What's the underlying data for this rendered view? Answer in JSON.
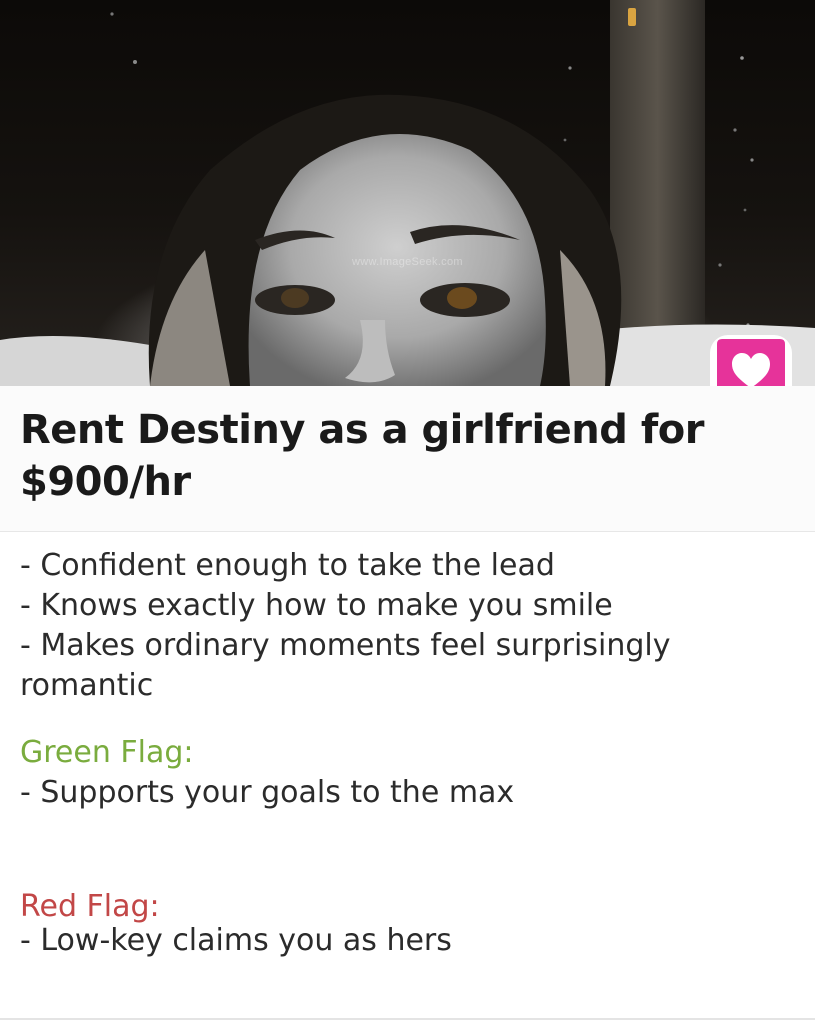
{
  "photo": {
    "alt_icon": "profile-photo",
    "watermark": "www.ImageSeek.com"
  },
  "badge": {
    "icon": "heart-chat-icon",
    "color": "#e6339a"
  },
  "title": "Rent Destiny as a girlfriend for $900/hr",
  "traits": [
    "- Confident enough to take the lead",
    "- Knows exactly how to make you smile",
    "- Makes ordinary moments feel surprisingly",
    "romantic"
  ],
  "green_flag": {
    "heading": "Green Flag:",
    "item": "- Supports your goals to the max",
    "color": "#7aac3e"
  },
  "red_flag": {
    "heading": "Red Flag:",
    "item": "- Low-key claims you as hers",
    "color": "#c24747"
  }
}
